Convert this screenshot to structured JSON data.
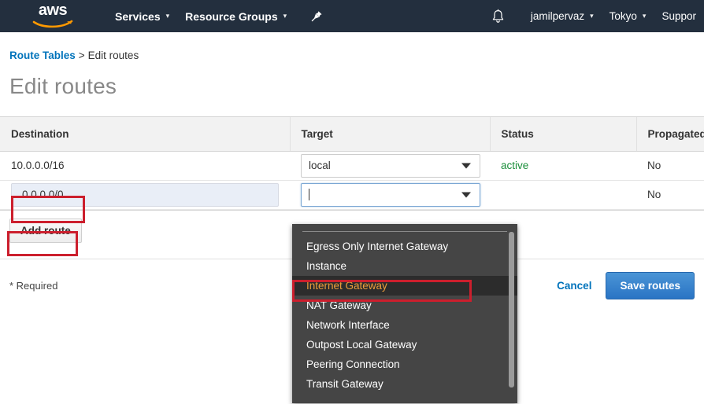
{
  "navbar": {
    "logo_text": "aws",
    "logo_name": "aws-logo",
    "items": [
      {
        "label": "Services",
        "caret": "▾"
      },
      {
        "label": "Resource Groups",
        "caret": "▾"
      }
    ],
    "pin_icon": "pin-icon",
    "bell_icon": "bell-icon",
    "right_items": [
      {
        "label": "jamilpervaz",
        "caret": "▾"
      },
      {
        "label": "Tokyo",
        "caret": "▾"
      },
      {
        "label": "Suppor",
        "caret": ""
      }
    ]
  },
  "breadcrumb": {
    "parent": "Route Tables",
    "separator": ">",
    "current": "Edit routes"
  },
  "page": {
    "title": "Edit routes"
  },
  "table": {
    "headers": [
      "Destination",
      "Target",
      "Status",
      "Propagated"
    ],
    "rows": [
      {
        "destination": "10.0.0.0/16",
        "target": "local",
        "status": "active",
        "propagated": "No"
      },
      {
        "destination": "0.0.0.0/0",
        "target": "",
        "status": "",
        "propagated": "No"
      }
    ]
  },
  "buttons": {
    "add_route": "Add route",
    "cancel": "Cancel",
    "save_routes": "Save routes"
  },
  "footer": {
    "required_note": "* Required"
  },
  "dropdown": {
    "items": [
      "Egress Only Internet Gateway",
      "Instance",
      "Internet Gateway",
      "NAT Gateway",
      "Network Interface",
      "Outpost Local Gateway",
      "Peering Connection",
      "Transit Gateway"
    ],
    "selected": "Internet Gateway"
  },
  "colors": {
    "nav_background": "#232f3e",
    "link_blue": "#0073bb",
    "status_green": "#1a8e3a",
    "annotation_red": "#cc1f2d",
    "dropdown_background": "#454545",
    "highlight_orange": "#ec9d3a",
    "save_button_blue": "#2a74c4",
    "aws_orange": "#ff9900"
  }
}
